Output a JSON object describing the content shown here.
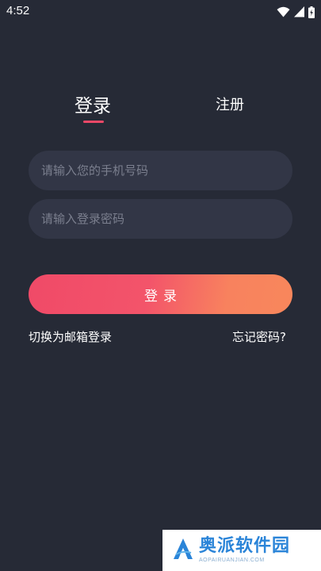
{
  "status_bar": {
    "time": "4:52"
  },
  "tabs": {
    "login_label": "登录",
    "register_label": "注册",
    "active": "login"
  },
  "form": {
    "phone_placeholder": "请输入您的手机号码",
    "phone_value": "",
    "password_placeholder": "请输入登录密码",
    "password_value": ""
  },
  "actions": {
    "login_button_label": "登录",
    "switch_to_email_label": "切换为邮箱登录",
    "forgot_password_label": "忘记密码?"
  },
  "watermark": {
    "title": "奥派软件园",
    "subtitle": "AOPAIRUANJIAN.COM"
  },
  "colors": {
    "background": "#262a36",
    "input_background": "#323646",
    "accent": "#ef4867",
    "gradient_end": "#f8875c"
  },
  "icons": {
    "wifi": "wifi-icon",
    "signal": "cell-signal-icon",
    "battery": "battery-charging-icon"
  }
}
